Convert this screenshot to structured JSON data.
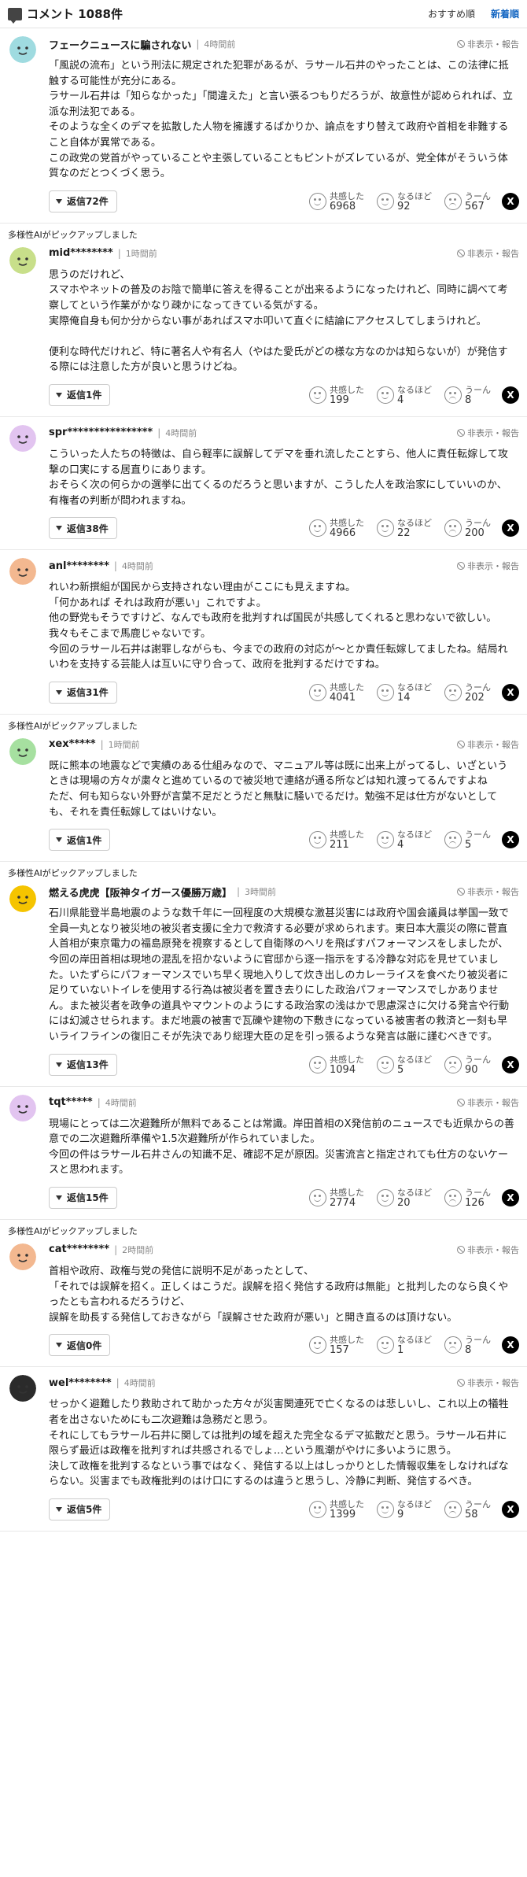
{
  "header": {
    "title": "コメント 1088件",
    "sort_recommended": "おすすめ順",
    "sort_newest": "新着順"
  },
  "labels": {
    "hide_report": "非表示・報告",
    "react_agree": "共感した",
    "react_nod": "なるほど",
    "react_hmm": "うーん",
    "x_share": "X"
  },
  "comments": [
    {
      "ai": "",
      "avatar_color": "#9fdbe0",
      "user": "フェークニュースに騙されない",
      "time": "4時間前",
      "body": "「風説の流布」という刑法に規定された犯罪があるが、ラサール石井のやったことは、この法律に抵触する可能性が充分にある。\nラサール石井は「知らなかった」「間違えた」と言い張るつもりだろうが、故意性が認められれば、立派な刑法犯である。\nそのような全くのデマを拡散した人物を擁護するばかりか、論点をすり替えて政府や首相を非難すること自体が異常である。\nこの政党の党首がやっていることや主張していることもピントがズレているが、党全体がそういう体質なのだとつくづく思う。",
      "replies": "返信72件",
      "agree": "6968",
      "nod": "92",
      "hmm": "567"
    },
    {
      "ai": "多様性AIがピックアップしました",
      "avatar_color": "#c8df8a",
      "user": "mid********",
      "time": "1時間前",
      "body": "思うのだけれど、\nスマホやネットの普及のお陰で簡単に答えを得ることが出来るようになったけれど、同時に調べて考察してという作業がかなり疎かになってきている気がする。\n実際俺自身も何か分からない事があればスマホ叩いて直ぐに結論にアクセスしてしまうけれど。\n\n便利な時代だけれど、特に著名人や有名人（やはた愛氏がどの様な方なのかは知らないが）が発信する際には注意した方が良いと思うけどね。",
      "replies": "返信1件",
      "agree": "199",
      "nod": "4",
      "hmm": "8"
    },
    {
      "ai": "",
      "avatar_color": "#e2c4f0",
      "user": "spr****************",
      "time": "4時間前",
      "body": "こういった人たちの特徴は、自ら軽率に誤解してデマを垂れ流したことすら、他人に責任転嫁して攻撃の口実にする居直りにあります。\nおそらく次の何らかの選挙に出てくるのだろうと思いますが、こうした人を政治家にしていいのか、有権者の判断が問われますね。",
      "replies": "返信38件",
      "agree": "4966",
      "nod": "22",
      "hmm": "200"
    },
    {
      "ai": "",
      "avatar_color": "#f3b890",
      "user": "anl********",
      "time": "4時間前",
      "body": "れいわ新撰組が国民から支持されない理由がここにも見えますね。\n「何かあれば それは政府が悪い」これですよ。\n他の野党もそうですけど、なんでも政府を批判すれば国民が共感してくれると思わないで欲しい。我々もそこまで馬鹿じゃないです。\n今回のラサール石井は謝罪しながらも、今までの政府の対応が～とか責任転嫁してましたね。結局れいわを支持する芸能人は互いに守り合って、政府を批判するだけですね。",
      "replies": "返信31件",
      "agree": "4041",
      "nod": "14",
      "hmm": "202"
    },
    {
      "ai": "多様性AIがピックアップしました",
      "avatar_color": "#a6e0a0",
      "user": "xex*****",
      "time": "1時間前",
      "body": "既に熊本の地震などで実績のある仕組みなので、マニュアル等は既に出来上がってるし、いざというときは現場の方々が粛々と進めているので被災地で連絡が通る所などは知れ渡ってるんですよね\nただ、何も知らない外野が言葉不足だとうだと無駄に騒いでるだけ。勉強不足は仕方がないとしても、それを責任転嫁してはいけない。",
      "replies": "返信1件",
      "agree": "211",
      "nod": "4",
      "hmm": "5"
    },
    {
      "ai": "多様性AIがピックアップしました",
      "avatar_color": "#f5c400",
      "user": "燃える虎虎【阪神タイガース優勝万歳】",
      "time": "3時間前",
      "body": "石川県能登半島地震のような数千年に一回程度の大規模な激甚災害には政府や国会議員は挙国一致で全員一丸となり被災地の被災者支援に全力で救済する必要が求められます。東日本大震災の際に菅直人首相が東京電力の福島原発を視察するとして自衛隊のヘリを飛ばすパフォーマンスをしましたが、今回の岸田首相は現地の混乱を招かないように官邸から逐一指示をする冷静な対応を見せていました。いたずらにパフォーマンスでいち早く現地入りして炊き出しのカレーライスを食べたり被災者に足りていないトイレを使用する行為は被災者を置き去りにした政治パフォーマンスでしかありません。また被災者を政争の道具やマウントのようにする政治家の浅はかで思慮深さに欠ける発言や行動には幻滅させられます。まだ地震の被害で瓦礫や建物の下敷きになっている被害者の救済と一刻も早いライフラインの復旧こそが先決であり総理大臣の足を引っ張るような発言は厳に謹むべきです。",
      "replies": "返信13件",
      "agree": "1094",
      "nod": "5",
      "hmm": "90"
    },
    {
      "ai": "",
      "avatar_color": "#e2c4f0",
      "user": "tqt*****",
      "time": "4時間前",
      "body": "現場にとっては二次避難所が無料であることは常識。岸田首相のX発信前のニュースでも近県からの善意での二次避難所準備や1.5次避難所が作られていました。\n今回の件はラサール石井さんの知識不足、確認不足が原因。災害流言と指定されても仕方のないケースと思われます。",
      "replies": "返信15件",
      "agree": "2774",
      "nod": "20",
      "hmm": "126"
    },
    {
      "ai": "多様性AIがピックアップしました",
      "avatar_color": "#f3b890",
      "user": "cat********",
      "time": "2時間前",
      "body": "首相や政府、政権与党の発信に説明不足があったとして、\n「それでは誤解を招く。正しくはこうだ。誤解を招く発信する政府は無能」と批判したのなら良くやったとも言われるだろうけど、\n誤解を助長する発信しておきながら「誤解させた政府が悪い」と開き直るのは頂けない。",
      "replies": "返信0件",
      "agree": "157",
      "nod": "1",
      "hmm": "8"
    },
    {
      "ai": "",
      "avatar_color": "#2b2b2b",
      "user": "wel********",
      "time": "4時間前",
      "body": "せっかく避難したり救助されて助かった方々が災害関連死で亡くなるのは悲しいし、これ以上の犠牲者を出さないためにも二次避難は急務だと思う。\nそれにしてもラサール石井に関しては批判の域を超えた完全なるデマ拡散だと思う。ラサール石井に限らず最近は政権を批判すれば共感されるでしょ…という風潮がやけに多いように思う。\n決して政権を批判するなという事ではなく、発信する以上はしっかりとした情報収集をしなければならない。災害までも政権批判のはけ口にするのは違うと思うし、冷静に判断、発信するべき。",
      "replies": "返信5件",
      "agree": "1399",
      "nod": "9",
      "hmm": "58"
    }
  ]
}
